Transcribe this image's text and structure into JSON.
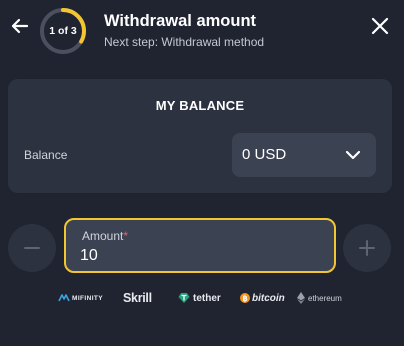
{
  "header": {
    "step_indicator": "1 of 3",
    "step_progress": 0.3333,
    "title": "Withdrawal amount",
    "subtitle": "Next step: Withdrawal method",
    "back_icon": "arrow-left-icon",
    "close_icon": "close-icon"
  },
  "balance": {
    "title": "MY BALANCE",
    "label": "Balance",
    "currency_value": "0 USD"
  },
  "amount": {
    "label": "Amount",
    "required_mark": "*",
    "value": "10"
  },
  "payment_logos": {
    "mifinity": "MIFINITY",
    "skrill": "Skrill",
    "tether": "tether",
    "bitcoin": "bitcoin",
    "ethereum": "ethereum"
  },
  "colors": {
    "background": "#1f2430",
    "card": "#2c3240",
    "field": "#3b4252",
    "accent": "#f3c533",
    "required": "#ff5a5a"
  }
}
